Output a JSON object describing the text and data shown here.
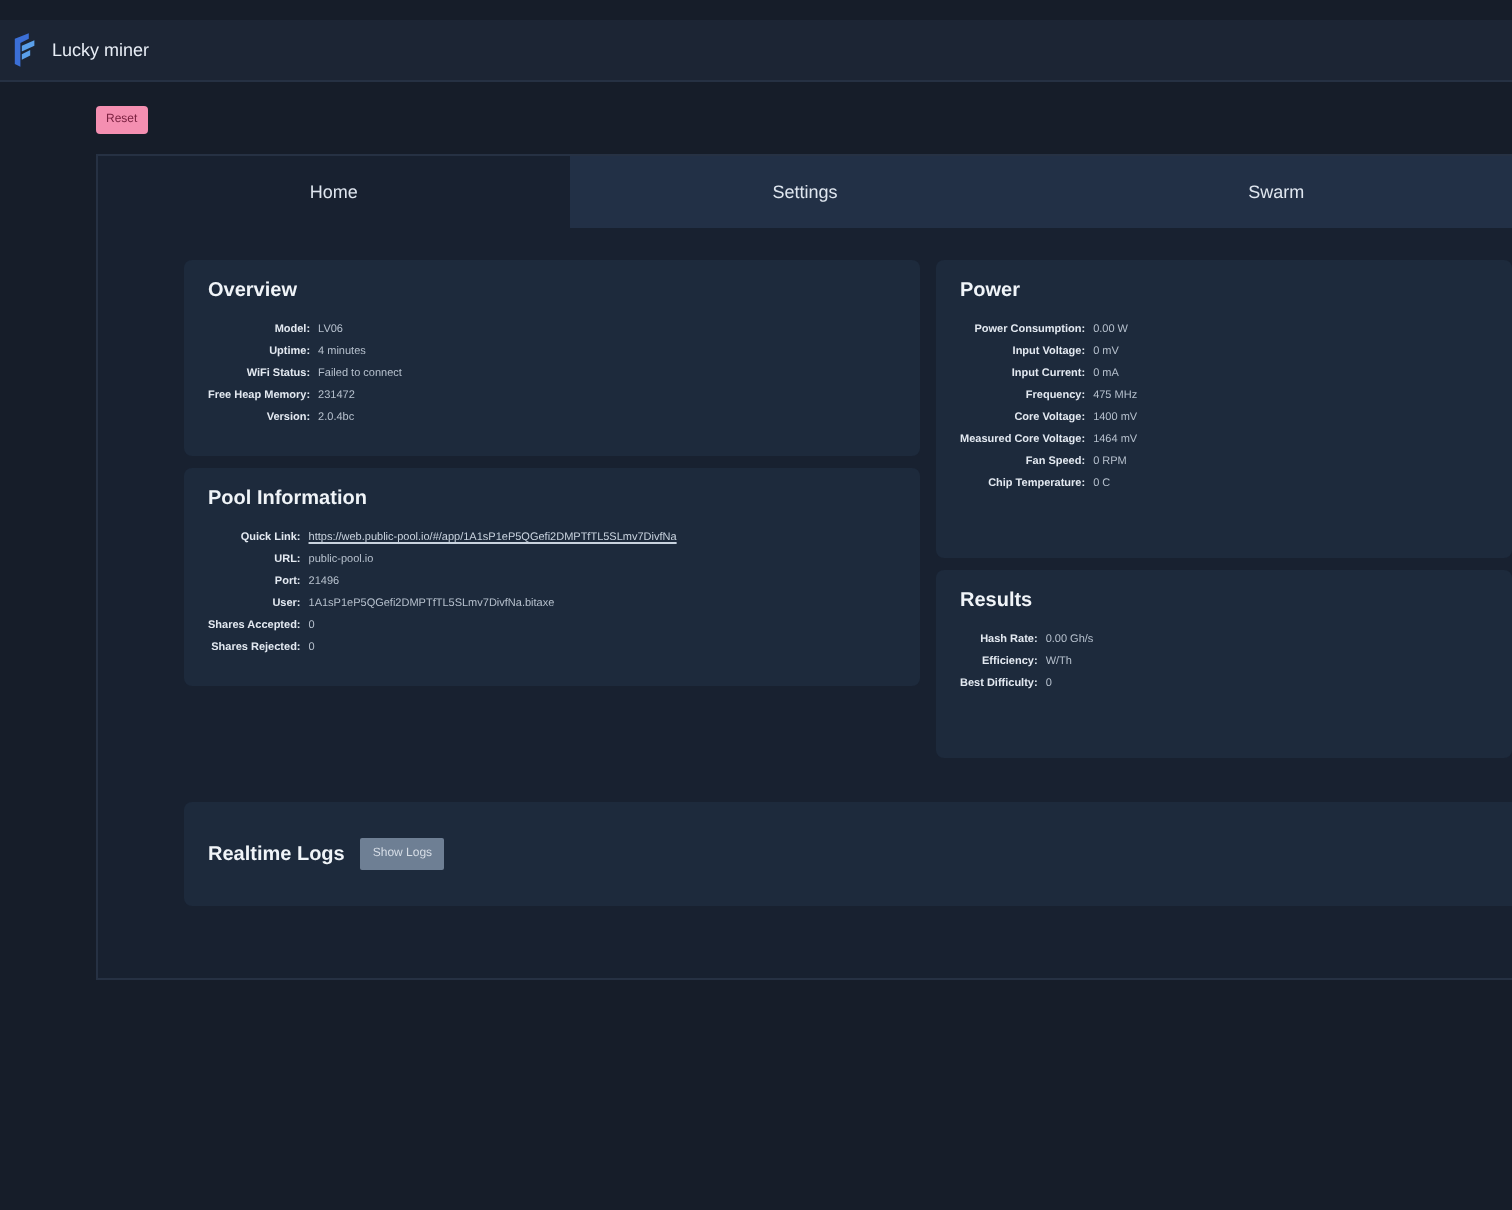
{
  "header": {
    "title": "Lucky miner"
  },
  "reset_button": "Reset",
  "tabs": [
    {
      "label": "Home",
      "selected": true
    },
    {
      "label": "Settings",
      "selected": false
    },
    {
      "label": "Swarm",
      "selected": false
    }
  ],
  "overview": {
    "title": "Overview",
    "fields": [
      {
        "label": "Model:",
        "value": "LV06"
      },
      {
        "label": "Uptime:",
        "value": "4 minutes"
      },
      {
        "label": "WiFi Status:",
        "value": "Failed to connect"
      },
      {
        "label": "Free Heap Memory:",
        "value": "231472"
      },
      {
        "label": "Version:",
        "value": "2.0.4bc"
      }
    ]
  },
  "pool": {
    "title": "Pool Information",
    "fields": [
      {
        "label": "Quick Link:",
        "value": "https://web.public-pool.io/#/app/1A1sP1eP5QGefi2DMPTfTL5SLmv7DivfNa",
        "kind": "link"
      },
      {
        "label": "URL:",
        "value": "public-pool.io",
        "kind": "text"
      },
      {
        "label": "Port:",
        "value": "21496",
        "kind": "text"
      },
      {
        "label": "User:",
        "value": "1A1sP1eP5QGefi2DMPTfTL5SLmv7DivfNa.bitaxe",
        "kind": "text"
      },
      {
        "label": "Shares Accepted:",
        "value": "0",
        "kind": "text"
      },
      {
        "label": "Shares Rejected:",
        "value": "0",
        "kind": "text"
      }
    ]
  },
  "power": {
    "title": "Power",
    "fields": [
      {
        "label": "Power Consumption:",
        "value": "0.00 W"
      },
      {
        "label": "Input Voltage:",
        "value": "0 mV"
      },
      {
        "label": "Input Current:",
        "value": "0 mA"
      },
      {
        "label": "Frequency:",
        "value": "475 MHz"
      },
      {
        "label": "Core Voltage:",
        "value": "1400 mV"
      },
      {
        "label": "Measured Core Voltage:",
        "value": "1464 mV"
      },
      {
        "label": "Fan Speed:",
        "value": "0 RPM"
      },
      {
        "label": "Chip Temperature:",
        "value": "0 C"
      }
    ]
  },
  "results": {
    "title": "Results",
    "fields": [
      {
        "label": "Hash Rate:",
        "value": "0.00 Gh/s"
      },
      {
        "label": "Efficiency:",
        "value": "W/Th"
      },
      {
        "label": "Best Difficulty:",
        "value": "0"
      }
    ]
  },
  "logs": {
    "title": "Realtime Logs",
    "button": "Show Logs"
  }
}
